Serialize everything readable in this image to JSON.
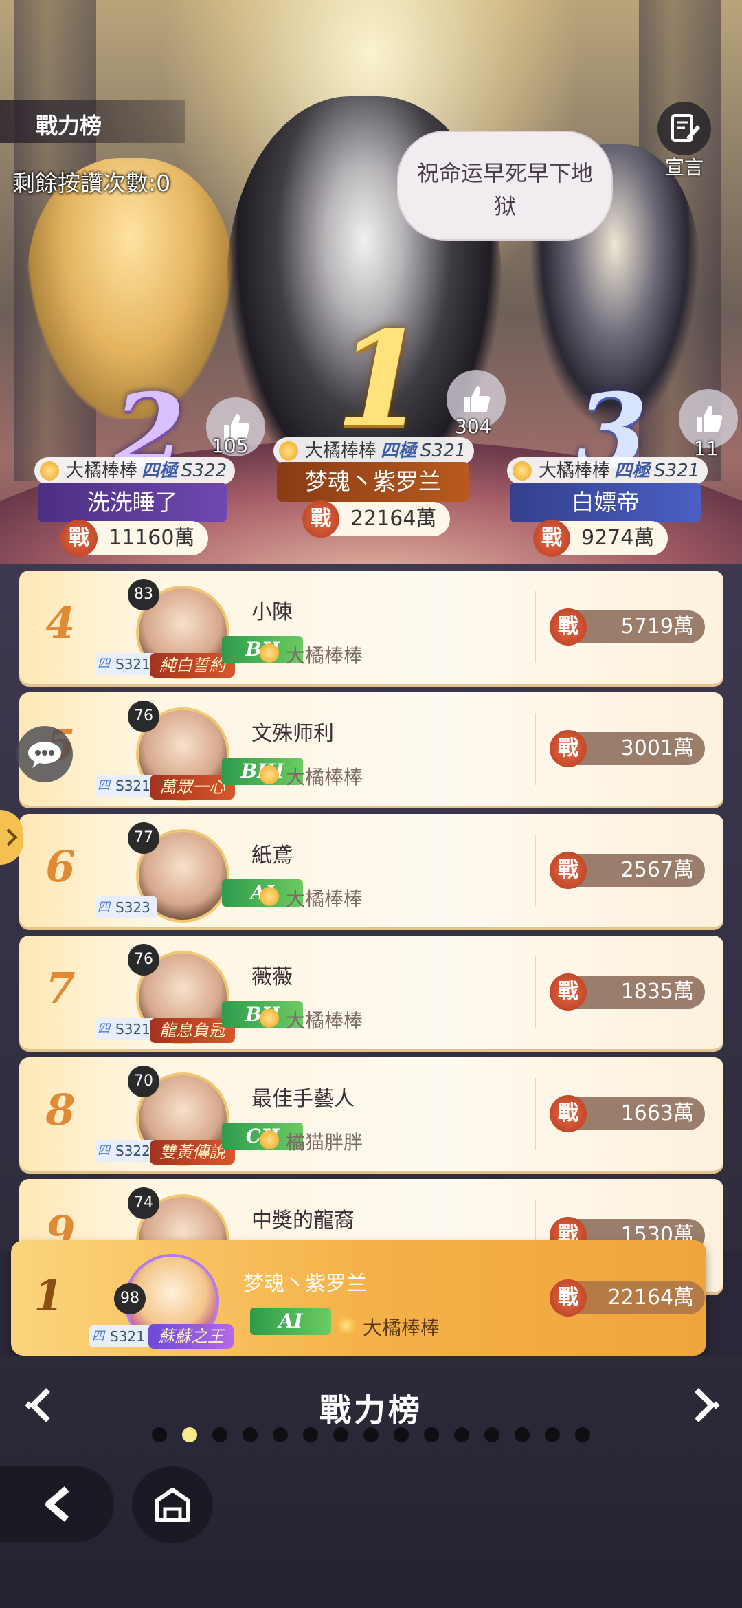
{
  "header": {
    "tab_label": "戰力榜",
    "likes_left": "剩餘按讚次數:0",
    "declare_label": "宣言",
    "speech": "祝命运早死早下地狱"
  },
  "podium": [
    {
      "rank": "2",
      "likes": "105",
      "guild": "大橘棒棒",
      "guild_tag": "四極",
      "server": "S322",
      "name": "洗洗睡了",
      "power": "11160萬"
    },
    {
      "rank": "1",
      "likes": "304",
      "guild": "大橘棒棒",
      "guild_tag": "四極",
      "server": "S321",
      "name": "梦魂丶紫罗兰",
      "power": "22164萬"
    },
    {
      "rank": "3",
      "likes": "11",
      "guild": "大橘棒棒",
      "guild_tag": "四極",
      "server": "S321",
      "name": "白嫖帝",
      "power": "9274萬"
    }
  ],
  "power_glyph": "戰",
  "rows": [
    {
      "rank": "4",
      "level": "83",
      "server": "S321",
      "title": "純白誓約",
      "grade": "BII",
      "name": "小陳",
      "guild": "大橘棒棒",
      "power": "5719萬"
    },
    {
      "rank": "5",
      "level": "76",
      "server": "S321",
      "title": "萬眾一心",
      "grade": "BIII",
      "name": "文殊师利",
      "guild": "大橘棒棒",
      "power": "3001萬"
    },
    {
      "rank": "6",
      "level": "77",
      "server": "S323",
      "title": "",
      "grade": "AI",
      "name": "紙鳶",
      "guild": "大橘棒棒",
      "power": "2567萬"
    },
    {
      "rank": "7",
      "level": "76",
      "server": "S321",
      "title": "龍息負冠",
      "grade": "BII",
      "name": "薇薇",
      "guild": "大橘棒棒",
      "power": "1835萬"
    },
    {
      "rank": "8",
      "level": "70",
      "server": "S322",
      "title": "雙黃傳說",
      "grade": "CII",
      "name": "最佳手藝人",
      "guild": "橘猫胖胖",
      "power": "1663萬"
    },
    {
      "rank": "9",
      "level": "74",
      "server": "",
      "title": "",
      "grade": "",
      "name": "中獎的龍裔",
      "guild": "",
      "power": "1530萬"
    }
  ],
  "self": {
    "rank": "1",
    "level": "98",
    "server": "S321",
    "title": "蘇蘇之王",
    "grade": "AI",
    "name": "梦魂丶紫罗兰",
    "guild": "大橘棒棒",
    "power": "22164萬"
  },
  "footer": {
    "title": "戰力榜",
    "page_count": 15,
    "active_page": 2
  },
  "colors": {
    "accent": "#f5b24a",
    "rank_text": "#e08a36",
    "power_pill": "#9b7d6b"
  }
}
